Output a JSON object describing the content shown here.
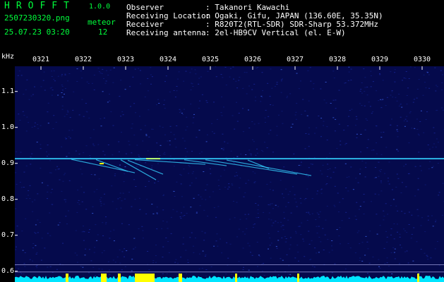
{
  "header": {
    "app_name": "HROFFT",
    "version": "1.0.0",
    "file_name": "2507230320.png",
    "datetime": "25.07.23 03:20",
    "meteor_label": "meteor",
    "meteor_count": "12",
    "fields": [
      {
        "label": "Observer",
        "value": ": Takanori Kawachi"
      },
      {
        "label": "Receiving Location",
        "value": ": Ogaki, Gifu, JAPAN (136.60E, 35.35N)"
      },
      {
        "label": "Receiver",
        "value": ": R820T2(RTL-SDR) SDR-Sharp 53.372MHz"
      },
      {
        "label": "Receiving antenna",
        "value": ": 2el-HB9CV Vertical (el. E-W)"
      }
    ]
  },
  "chart_data": {
    "type": "heatmap",
    "ylabel": "kHz",
    "yticks": [
      "1.1",
      "1.0",
      "0.9",
      "0.8",
      "0.7",
      "0.6"
    ],
    "ylim": [
      0.57,
      1.17
    ],
    "xticks": [
      "0321",
      "0322",
      "0323",
      "0324",
      "0325",
      "0326",
      "0327",
      "0328",
      "0329",
      "0330"
    ],
    "carrier_khz": 0.913,
    "colors": {
      "background": "#050a4c",
      "signal": "#34d0ff",
      "strong": "#ffff00",
      "power": "#00e5ff"
    }
  }
}
